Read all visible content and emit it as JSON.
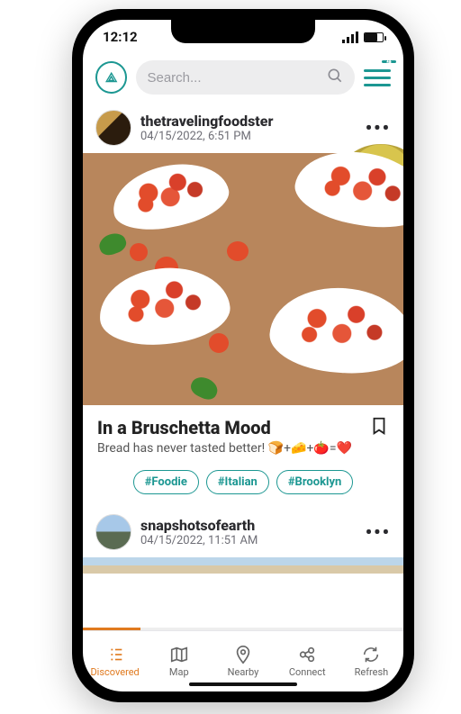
{
  "statusbar": {
    "time": "12:12"
  },
  "header": {
    "search_placeholder": "Search...",
    "menu_badge": "4"
  },
  "feed": [
    {
      "user": "thetravelingfoodster",
      "date": "04/15/2022, 6:51 PM",
      "title": "In a Bruschetta Mood",
      "desc": "Bread has never tasted better! 🍞+🧀+🍅=❤️",
      "tags": [
        "#Foodie",
        "#Italian",
        "#Brooklyn"
      ]
    },
    {
      "user": "snapshotsofearth",
      "date": "04/15/2022, 11:51 AM"
    }
  ],
  "nav": {
    "items": [
      {
        "label": "Discovered"
      },
      {
        "label": "Map"
      },
      {
        "label": "Nearby"
      },
      {
        "label": "Connect"
      },
      {
        "label": "Refresh"
      }
    ]
  }
}
